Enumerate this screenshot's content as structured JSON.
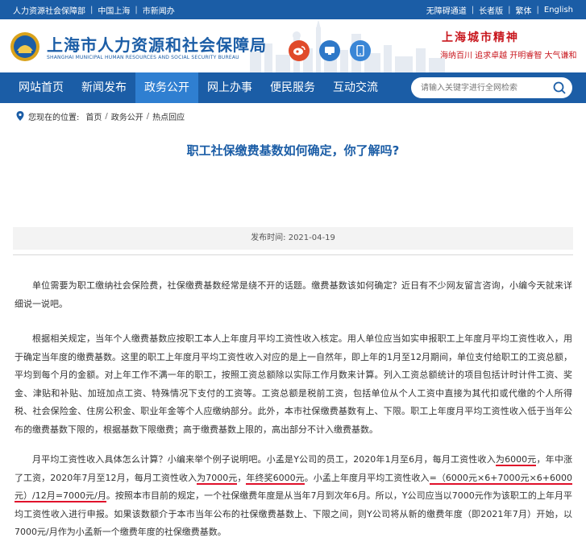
{
  "topbar": {
    "links_left": [
      "人力资源社会保障部",
      "中国上海",
      "市新闻办"
    ],
    "links_right": [
      "无障碍通道",
      "长者版",
      "繁体",
      "English"
    ]
  },
  "header": {
    "logo_cn": "上海市人力资源和社会保障局",
    "logo_en": "SHANGHAI MUNICIPAL HUMAN RESOURCES AND SOCIAL SECURITY BUREAU",
    "social_icons": [
      "weibo-icon",
      "wechat-icon",
      "mobile-icon"
    ],
    "spirit_title": "上海城市精神",
    "spirit_text": "海纳百川 追求卓越 开明睿智 大气谦和"
  },
  "nav": {
    "items": [
      "网站首页",
      "新闻发布",
      "政务公开",
      "网上办事",
      "便民服务",
      "互动交流"
    ],
    "active_index": 2,
    "search_placeholder": "请输入关键字进行全网检索"
  },
  "breadcrumb": {
    "label": "您现在的位置:",
    "items": [
      "首页",
      "政务公开",
      "热点回应"
    ]
  },
  "article": {
    "title": "职工社保缴费基数如何确定，你了解吗?",
    "date": "发布时间:  2021-04-19",
    "p1": "单位需要为职工缴纳社会保险费，社保缴费基数经常是绕不开的话题。缴费基数该如何确定？近日有不少网友留言咨询，小编今天就来详细说一说吧。",
    "p2": "根据相关规定，当年个人缴费基数应按职工本人上年度月平均工资性收入核定。用人单位应当如实申报职工上年度月平均工资性收入，用于确定当年度的缴费基数。这里的职工上年度月平均工资性收入对应的是上一自然年，即上年的1月至12月期间，单位支付给职工的工资总额，平均到每个月的金额。对上年工作不满一年的职工，按照工资总额除以实际工作月数来计算。列入工资总额统计的项目包括计时计件工资、奖金、津贴和补贴、加班加点工资、特殊情况下支付的工资等。工资总额是税前工资，包括单位从个人工资中直接为其代扣或代缴的个人所得税、社会保险金、住房公积金、职业年金等个人应缴纳部分。此外，本市社保缴费基数有上、下限。职工上年度月平均工资性收入低于当年公布的缴费基数下限的，根据基数下限缴费；高于缴费基数上限的，高出部分不计入缴费基数。",
    "p3_a": "月平均工资性收入具体怎么计算？小编来举个例子说明吧。小孟是Y公司的员工，2020年1月至6月，每月工资性收入",
    "p3_u1": "为6000元",
    "p3_b": "，年中涨了工资，2020年7月至12月，每月工资性收入",
    "p3_u2": "为7000元",
    "p3_c": "，",
    "p3_u3": "年终奖6000元",
    "p3_d": "。小孟上年度月平均工资性收入",
    "p3_u4": "=（6000元×6+7000元×6+6000元）/12月=7000元/月",
    "p3_e": "。按照本市目前的规定，一个社保缴费年度是从当年7月到次年6月。所以，Y公司应当以7000元作为该职工的上年月平均工资性收入进行申报。如果该数额介于本市当年公布的社保缴费基数上、下限之间，则Y公司将从新的缴费年度（即2021年7月）开始，以7000元/月作为小孟新一个缴费年度的社保缴费基数。"
  }
}
